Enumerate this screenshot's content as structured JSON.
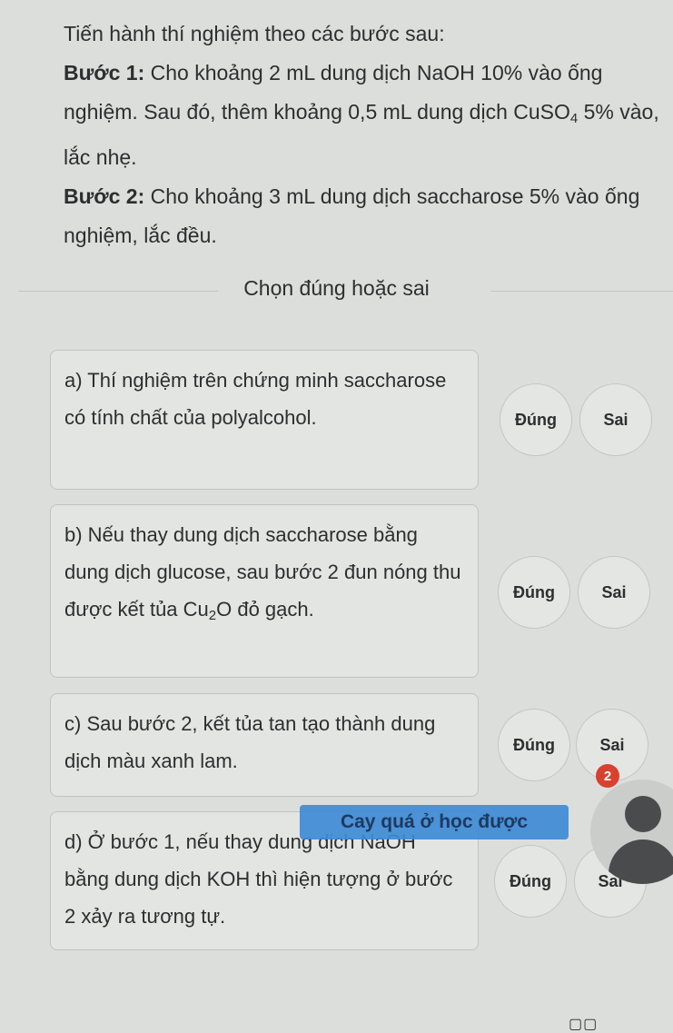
{
  "intro": {
    "heading": "Tiến hành thí nghiệm theo các bước sau:",
    "step1_label": "Bước 1:",
    "step1_text_a": " Cho khoảng 2 mL dung dịch NaOH 10% vào ống nghiệm. Sau đó, thêm khoảng 0,5 mL dung dịch CuSO",
    "step1_sub": "4",
    "step1_text_b": " 5% vào, lắc nhẹ.",
    "step2_label": "Bước 2:",
    "step2_text": " Cho khoảng 3 mL dung dịch saccharose 5% vào ống nghiệm, lắc đều."
  },
  "section_title": "Chọn đúng hoặc sai",
  "statements": [
    {
      "text": "a) Thí nghiệm trên chứng minh saccharose có tính chất của polyalcohol.",
      "true_label": "Đúng",
      "false_label": "Sai"
    },
    {
      "text_a": "b) Nếu thay dung dịch saccharose bằng dung dịch glucose, sau bước 2 đun nóng thu được kết tủa Cu",
      "sub": "2",
      "text_b": "O đỏ gạch.",
      "true_label": "Đúng",
      "false_label": "Sai"
    },
    {
      "text": "c) Sau bước 2, kết tủa tan tạo thành dung dịch màu xanh lam.",
      "true_label": "Đúng",
      "false_label": "Sai"
    },
    {
      "text": "d) Ở bước 1, nếu thay dung dịch NaOH bằng dung dịch KOH thì hiện tượng ở bước 2 xảy ra tương tự.",
      "true_label": "Đúng",
      "false_label": "Sai"
    }
  ],
  "notification_count": "2",
  "banner_text": "Cay quá ở học được",
  "colors": {
    "banner": "#3f8bd6",
    "badge": "#d8412f",
    "background": "#dcdedb"
  },
  "icons": {
    "avatar": "avatar-icon",
    "bottom": "recent-apps-icon",
    "bottom_glyph": "▢▢"
  }
}
